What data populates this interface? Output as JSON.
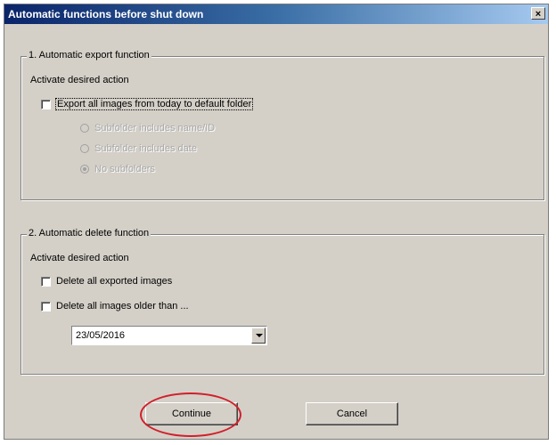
{
  "window": {
    "title": "Automatic functions before shut down",
    "close_label": "×"
  },
  "export_section": {
    "legend": "1. Automatic export function",
    "instruction": "Activate desired action",
    "checkbox_label": "Export all images from today to default folder",
    "checked": false,
    "radio_options": [
      {
        "label": "Subfolder includes name/ID",
        "selected": false
      },
      {
        "label": "Subfolder includes date",
        "selected": false
      },
      {
        "label": "No subfolders",
        "selected": true
      }
    ]
  },
  "delete_section": {
    "legend": "2. Automatic delete function",
    "instruction": "Activate desired action",
    "options": [
      {
        "label": "Delete all exported images",
        "checked": false
      },
      {
        "label": "Delete all images older than ...",
        "checked": false
      }
    ],
    "date_value": "23/05/2016"
  },
  "buttons": {
    "continue_label": "Continue",
    "cancel_label": "Cancel"
  },
  "colors": {
    "dialog_bg": "#d4d0c8",
    "title_bar_start": "#0a246a",
    "annotation_ring": "#d21f2b"
  }
}
